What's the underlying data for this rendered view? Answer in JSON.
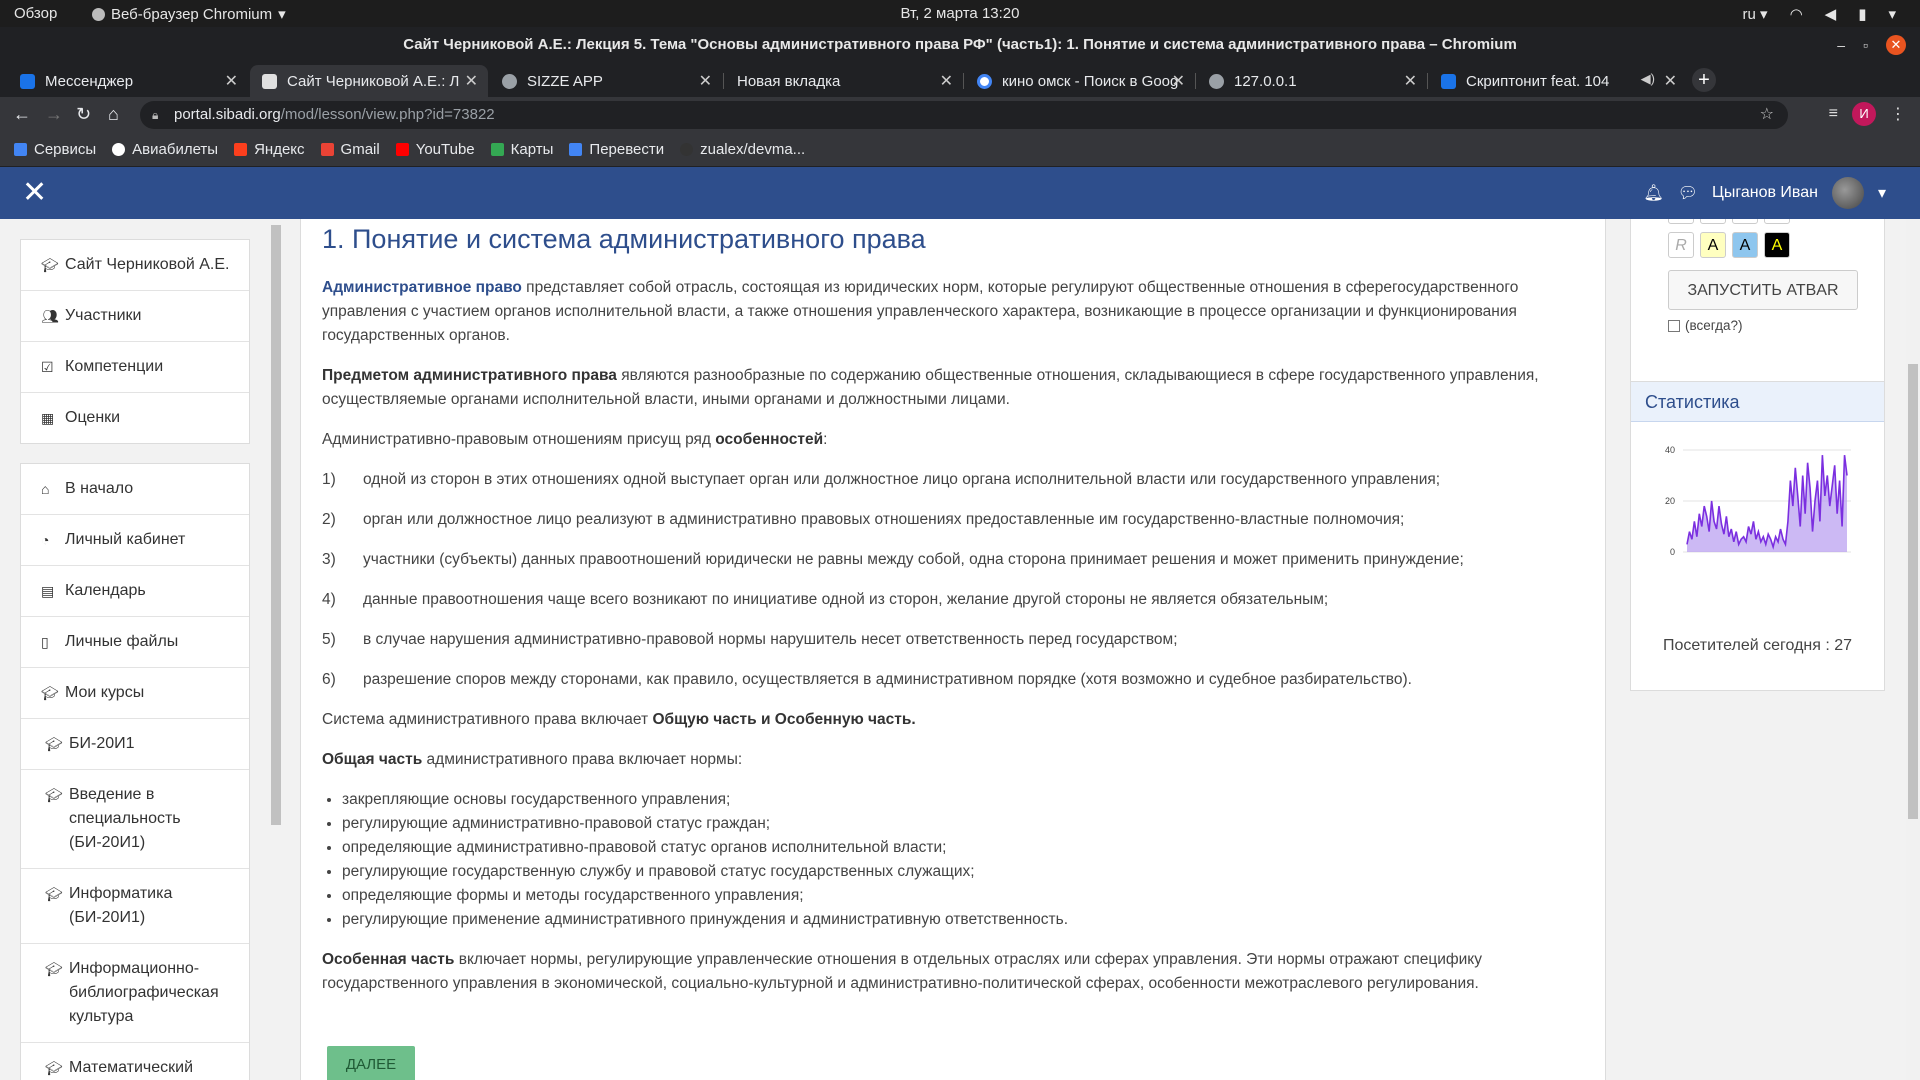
{
  "os_bar": {
    "activities": "Обзор",
    "app_name": "Веб-браузер Chromium",
    "clock": "Вт, 2 марта  13:20",
    "lang": "ru"
  },
  "window": {
    "title": "Сайт Черниковой А.Е.: Лекция 5. Тема \"Основы административного права РФ\" (часть1): 1. Понятие и система административного права – Chromium"
  },
  "tabs": [
    {
      "label": "Мессенджер",
      "color": "#1a73e8"
    },
    {
      "label": "Сайт Черниковой А.Е.: Л",
      "color": "#e0e0e0"
    },
    {
      "label": "SIZZE APP",
      "color": "#9aa0a6"
    },
    {
      "label": "Новая вкладка",
      "color": ""
    },
    {
      "label": "кино омск - Поиск в Goog",
      "color": "#4285f4"
    },
    {
      "label": "127.0.0.1",
      "color": "#9aa0a6"
    },
    {
      "label": "Скриптонит feat. 104",
      "color": "#1a73e8"
    }
  ],
  "address": {
    "host": "portal.sibadi.org",
    "path": "/mod/lesson/view.php?id=73822"
  },
  "bookmarks": [
    {
      "label": "Сервисы",
      "color": "#4285f4"
    },
    {
      "label": "Авиабилеты",
      "color": "#ffffff"
    },
    {
      "label": "Яндекс",
      "color": "#fc3f1d"
    },
    {
      "label": "Gmail",
      "color": "#ea4335"
    },
    {
      "label": "YouTube",
      "color": "#ff0000"
    },
    {
      "label": "Карты",
      "color": "#34a853"
    },
    {
      "label": "Перевести",
      "color": "#4285f4"
    },
    {
      "label": "zualex/devma...",
      "color": "#333333"
    }
  ],
  "moodle_nav": {
    "user": "Цыганов Иван"
  },
  "drawer": {
    "group1": [
      {
        "label": "Сайт Черниковой А.Е.",
        "icon": "graduation-cap-icon"
      },
      {
        "label": "Участники",
        "icon": "users-icon"
      },
      {
        "label": "Компетенции",
        "icon": "check-square-icon"
      },
      {
        "label": "Оценки",
        "icon": "table-icon"
      }
    ],
    "group2": [
      {
        "label": "В начало",
        "icon": "home-icon"
      },
      {
        "label": "Личный кабинет",
        "icon": "dashboard-icon"
      },
      {
        "label": "Календарь",
        "icon": "calendar-icon"
      },
      {
        "label": "Личные файлы",
        "icon": "file-icon"
      },
      {
        "label": "Мои курсы",
        "icon": "graduation-cap-icon"
      },
      {
        "label": "БИ-20И1",
        "icon": "graduation-cap-icon"
      },
      {
        "label": "Введение в специальность (БИ-20И1)",
        "icon": "graduation-cap-icon"
      },
      {
        "label": "Информатика (БИ-20И1)",
        "icon": "graduation-cap-icon"
      },
      {
        "label": "Информационно-библиографическая культура",
        "icon": "graduation-cap-icon"
      },
      {
        "label": "Математический анализ АСб, БИ",
        "icon": "graduation-cap-icon"
      }
    ]
  },
  "lesson": {
    "title": "1. Понятие и система административного права",
    "p1_term": "Административное право",
    "p1_text": " представляет собой отрасль, состоящая из  юридических норм, которые регулируют общественные отношения в сферегосударственного управления с участием органов исполнительной власти, а также отношения управленческого характера, возникающие в процессе организации и функционирования государственных органов.",
    "p2_term": "Предметом административного права",
    "p2_text": "  являются разнообразные по содержанию общественные отношения, складывающиеся в сфере государственного управления, осуществляемые органами исполнительной власти, иными органами и должностными лицами.",
    "p3_text": "Административно-правовым отношениям присущ ряд ",
    "p3_bold": "особенностей",
    "p3_end": ":",
    "features": [
      {
        "n": "1)",
        "text": "одной из сторон в этих отношениях одной выступает орган или должностное лицо органа исполнительной власти или государственного управления;"
      },
      {
        "n": "2)",
        "text": "орган или должностное лицо реализуют в административно правовых отношениях предоставленные им государственно-властные полномочия;"
      },
      {
        "n": "3)",
        "text": "участники (субъекты) данных правоотношений юридически не равны между собой, одна сторона принимает решения и может применить принуждение;"
      },
      {
        "n": "4)",
        "text": "данные правоотношения чаще всего возникают по инициативе одной из сторон, желание другой стороны не является обязательным;"
      },
      {
        "n": "5)",
        "text": "в случае нарушения административно-правовой нормы нарушитель несет ответственность перед государством;"
      },
      {
        "n": "6)",
        "text": "разрешение споров между сторонами, как правило, осуществляется в административном порядке (хотя возможно и судебное разбирательство)."
      }
    ],
    "p4_text": "Система административного права включает ",
    "p4_bold": "Общую часть и Особенную часть.",
    "p5_bold": "Общая часть",
    "p5_text": " административного права включает нормы:",
    "norms": [
      "закрепляющие основы государственного управления;",
      "регулирующие административно-правовой статус граждан;",
      "определяющие административно-правовой статус органов исполнительной власти;",
      "регулирующие государственную службу и правовой статус государственных служащих;",
      "определяющие формы и методы государственного управления;",
      "регулирующие применение административного принуждения и административную ответственность."
    ],
    "p6_bold": "Особенная часть",
    "p6_text": " включает нормы, регулирующие управленческие отношения в отдельных отраслях или сферах управления. Эти нормы отражают специфику государственного управления в экономической, социально-культурной и административно-политической сферах, особенности межотраслевого регулирования.",
    "next_button": "ДАЛЕЕ"
  },
  "atbar": {
    "r_label": "R",
    "a_label": "A",
    "launch_button": "ЗАПУСТИТЬ ATBAR",
    "always_label": "(всегда?)"
  },
  "stats": {
    "header": "Статистика",
    "visitors_today": "Посетителей сегодня : 27"
  },
  "chart_data": {
    "type": "area",
    "title": "",
    "xlabel": "",
    "ylabel": "",
    "ylim": [
      0,
      40
    ],
    "yticks": [
      "40",
      "20",
      "0"
    ],
    "series": [
      {
        "color": "#7b2fe0",
        "values": [
          3,
          8,
          5,
          12,
          6,
          15,
          10,
          18,
          14,
          8,
          20,
          12,
          9,
          18,
          11,
          7,
          14,
          6,
          9,
          4,
          8,
          3,
          5,
          6,
          4,
          10,
          7,
          12,
          5,
          8,
          4,
          6,
          3,
          7,
          5,
          2,
          6,
          4,
          9,
          5,
          3,
          12,
          28,
          18,
          33,
          22,
          10,
          30,
          15,
          35,
          25,
          8,
          20,
          28,
          12,
          38,
          22,
          30,
          18,
          26,
          34,
          15,
          28,
          10,
          38,
          30
        ]
      }
    ]
  }
}
